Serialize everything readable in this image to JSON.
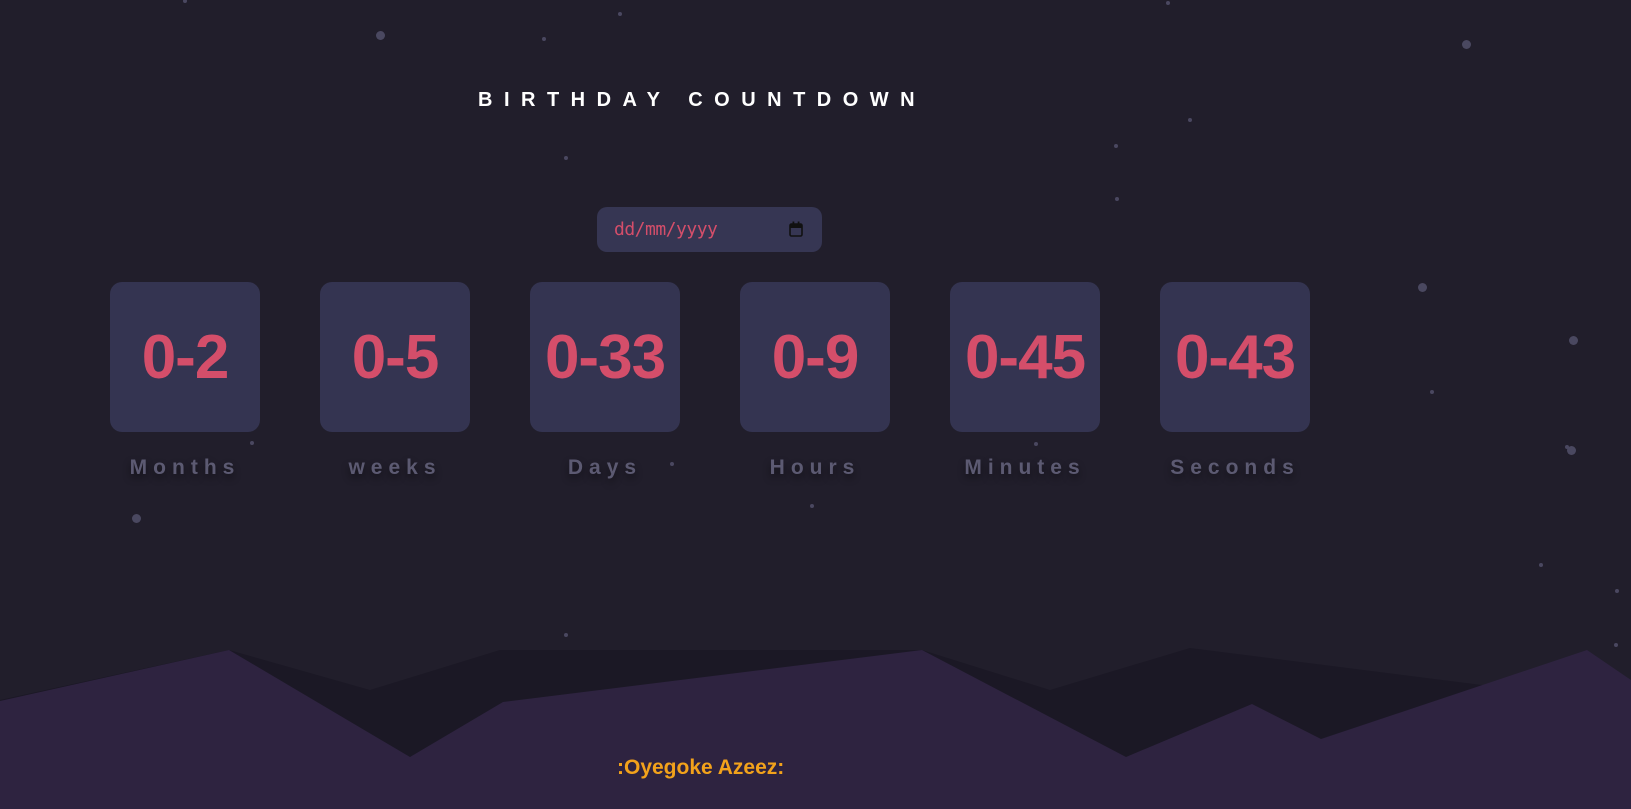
{
  "header": {
    "title": "BIRTHDAY COUNTDOWN"
  },
  "date_input": {
    "placeholder": "dd/mm/yyyy",
    "icon": "calendar-icon"
  },
  "countdown": [
    {
      "value": "0-2",
      "label": "Months"
    },
    {
      "value": "0-5",
      "label": "weeks"
    },
    {
      "value": "0-33",
      "label": "Days"
    },
    {
      "value": "0-9",
      "label": "Hours"
    },
    {
      "value": "0-45",
      "label": "Minutes"
    },
    {
      "value": "0-43",
      "label": "Seconds"
    }
  ],
  "footer": {
    "author": ":Oyegoke Azeez:"
  },
  "colors": {
    "background": "#211e2b",
    "box": "#343451",
    "accent": "#d44e6a",
    "label": "#5c5a72",
    "footer_text": "#f2a21b",
    "hills": "#2e2340"
  }
}
